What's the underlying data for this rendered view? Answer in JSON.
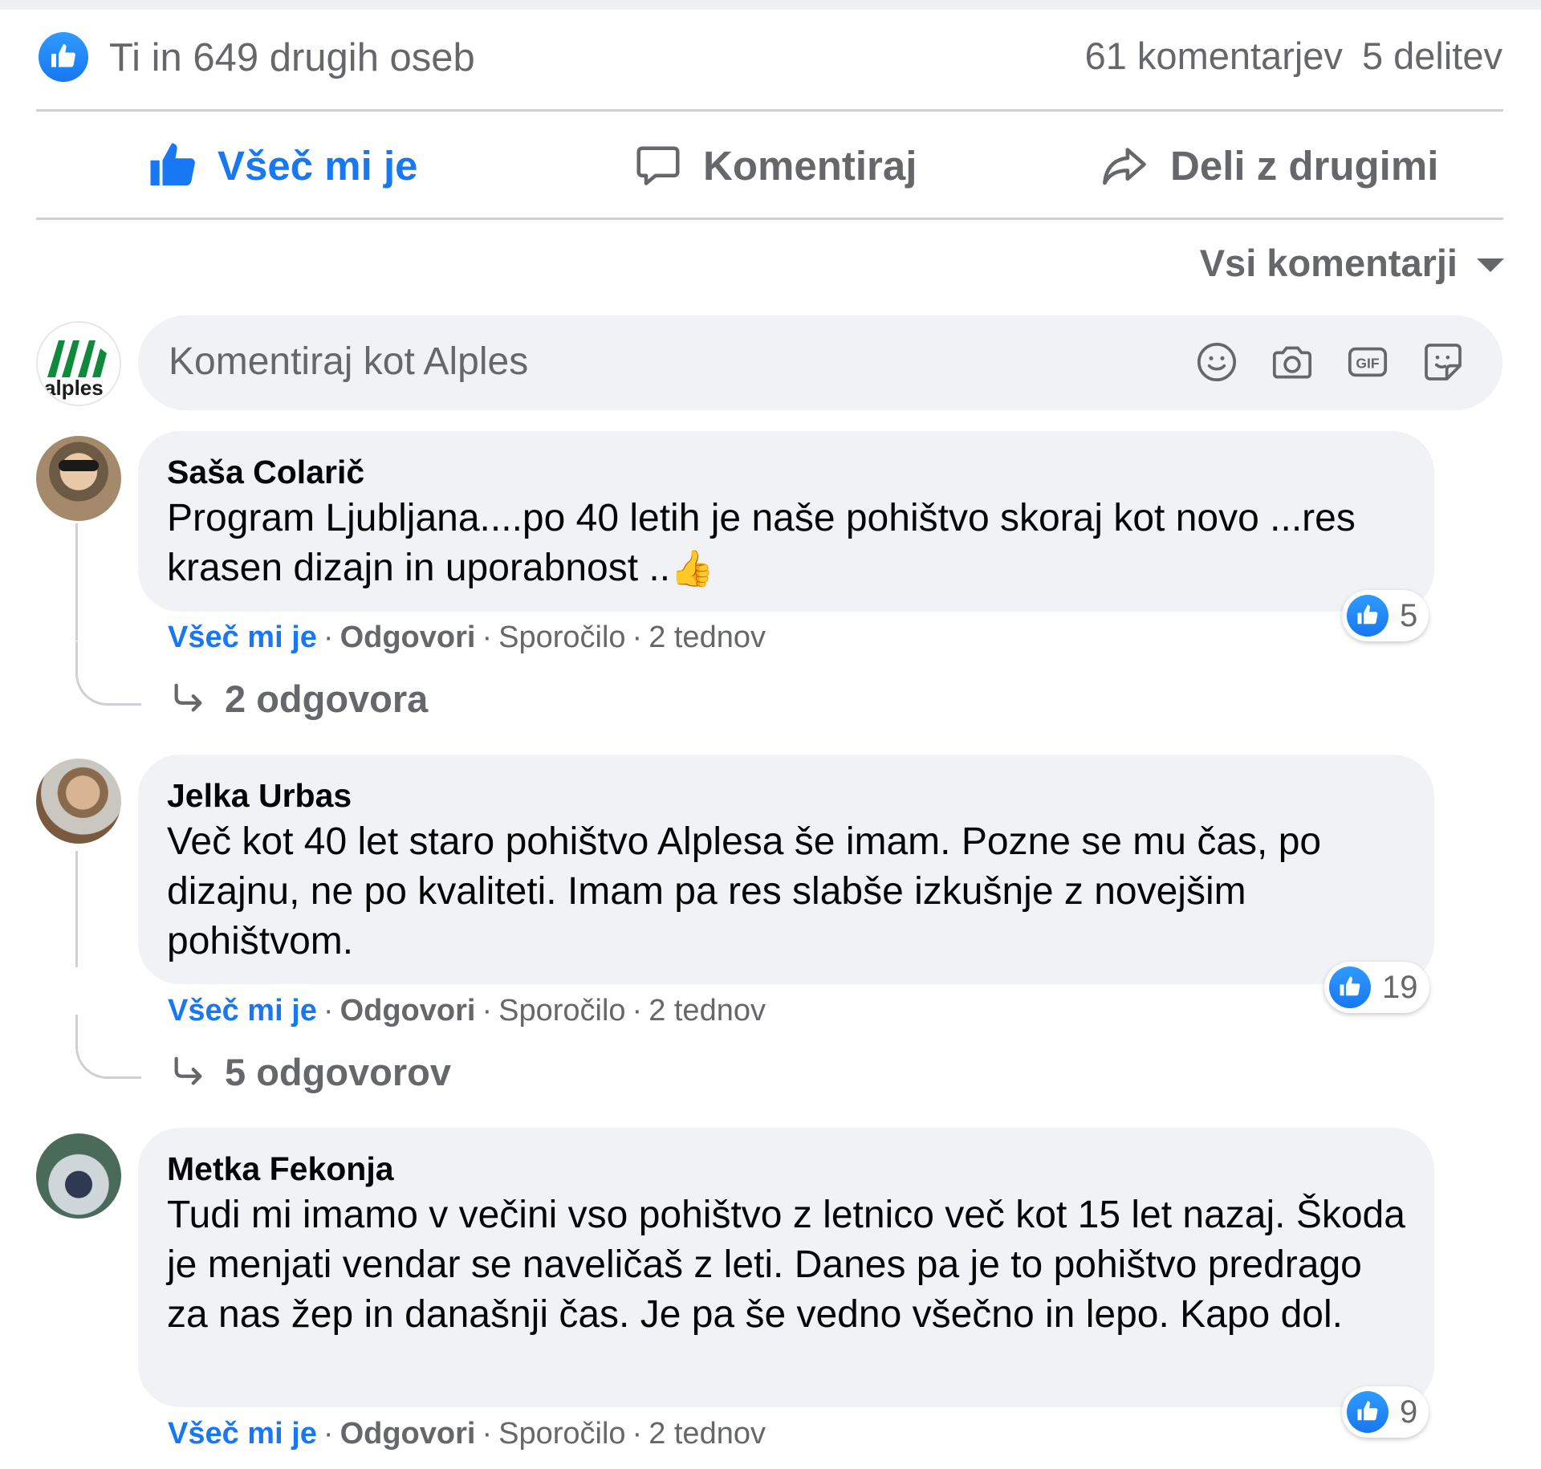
{
  "summary": {
    "likes_text": "Ti in 649 drugih oseb",
    "comments_count": "61 komentarjev",
    "shares_count": "5 delitev"
  },
  "actions": {
    "like": "Všeč mi je",
    "comment": "Komentiraj",
    "share": "Deli z drugimi"
  },
  "sort": {
    "label": "Vsi komentarji"
  },
  "composer": {
    "avatar_text": "alples",
    "placeholder": "Komentiraj kot Alples",
    "icons": [
      "emoji-icon",
      "camera-icon",
      "gif-icon",
      "sticker-icon"
    ]
  },
  "comments": [
    {
      "author": "Saša Colarič",
      "text": "Program Ljubljana....po 40 letih je naše pohištvo skoraj kot novo ...res krasen dizajn in uporabnost ..",
      "emoji": "👍",
      "likes": "5",
      "like_label": "Všeč mi je",
      "reply_label": "Odgovori",
      "message_label": "Sporočilo",
      "time": "2 tednov",
      "replies": "2 odgovora"
    },
    {
      "author": "Jelka Urbas",
      "text": "Več kot 40 let staro pohištvo Alplesa še imam. Pozne se mu čas, po dizajnu, ne po kvaliteti. Imam pa res slabše izkušnje z novejšim pohištvom.",
      "likes": "19",
      "like_label": "Všeč mi je",
      "reply_label": "Odgovori",
      "message_label": "Sporočilo",
      "time": "2 tednov",
      "replies": "5 odgovorov"
    },
    {
      "author": "Metka Fekonja",
      "text": "Tudi mi imamo v večini vso pohištvo z letnico več kot 15 let nazaj. Škoda je menjati vendar se naveličaš z leti. Danes pa je to pohištvo predrago za nas žep in današnji čas. Je pa še vedno všečno in lepo. Kapo dol.",
      "likes": "9",
      "like_label": "Všeč mi je",
      "reply_label": "Odgovori",
      "message_label": "Sporočilo",
      "time": "2 tednov"
    }
  ],
  "colors": {
    "accent": "#1877f2",
    "muted": "#65676b",
    "bubble": "#f0f2f5",
    "logo_green": "#0f8a3c"
  }
}
